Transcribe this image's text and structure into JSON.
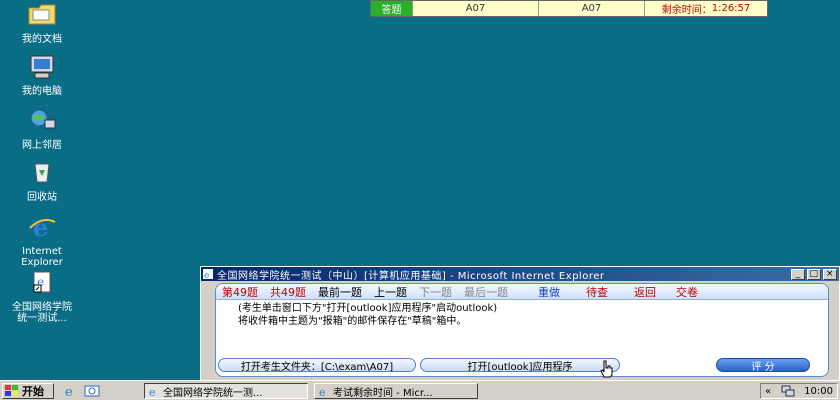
{
  "desktop": {
    "icons": [
      {
        "label": "我的文档",
        "icon": "my-documents-icon"
      },
      {
        "label": "我的电脑",
        "icon": "my-computer-icon"
      },
      {
        "label": "网上邻居",
        "icon": "network-icon"
      },
      {
        "label": "回收站",
        "icon": "recycle-bin-icon"
      },
      {
        "label_line1": "Internet",
        "label_line2": "Explorer",
        "icon": "internet-explorer-icon"
      },
      {
        "label_line1": "全国网络学院",
        "label_line2": "统一测试...",
        "icon": "shortcut-icon"
      }
    ]
  },
  "status_bar": {
    "state": "答题",
    "exam_id_1": "A07",
    "exam_id_2": "A07",
    "remaining_label": "剩余时间：",
    "remaining_time": "1:26:57"
  },
  "exam_window": {
    "title": "全国网络学院统一测试（中山）[计算机应用基础] - Microsoft Internet Explorer",
    "nav": {
      "current_prefix": "第",
      "current_num": "49",
      "current_suffix": "题",
      "total_prefix": "共",
      "total_num": "49",
      "total_suffix": "题",
      "first": "最前一题",
      "prev": "上一题",
      "next": "下一题",
      "last": "最后一题",
      "redo": "重做",
      "review": "待查",
      "back": "返回",
      "submit": "交卷"
    },
    "question": {
      "line1": "(考生单击窗口下方\"打开[outlook]应用程序\"启动outlook)",
      "line2": "将收件箱中主题为\"报箱\"的邮件保存在\"草稿\"箱中。"
    },
    "buttons": {
      "open_folder": "打开考生文件夹：[C:\\exam\\A07]",
      "open_outlook": "打开[outlook]应用程序",
      "score": "评 分"
    }
  },
  "taskbar": {
    "start": "开始",
    "tasks": [
      {
        "label": "全国网络学院统一测...",
        "active": true
      },
      {
        "label": "考试剩余时间 - Micr...",
        "active": false
      }
    ],
    "tray_chevron": "«",
    "clock": "10:00"
  },
  "colors": {
    "desktop": "#0a6d86",
    "titlebar": "#0a246a",
    "status_green": "#2bb02b",
    "accent_red": "#c00000",
    "nav_blue": "#1a3fc8"
  }
}
